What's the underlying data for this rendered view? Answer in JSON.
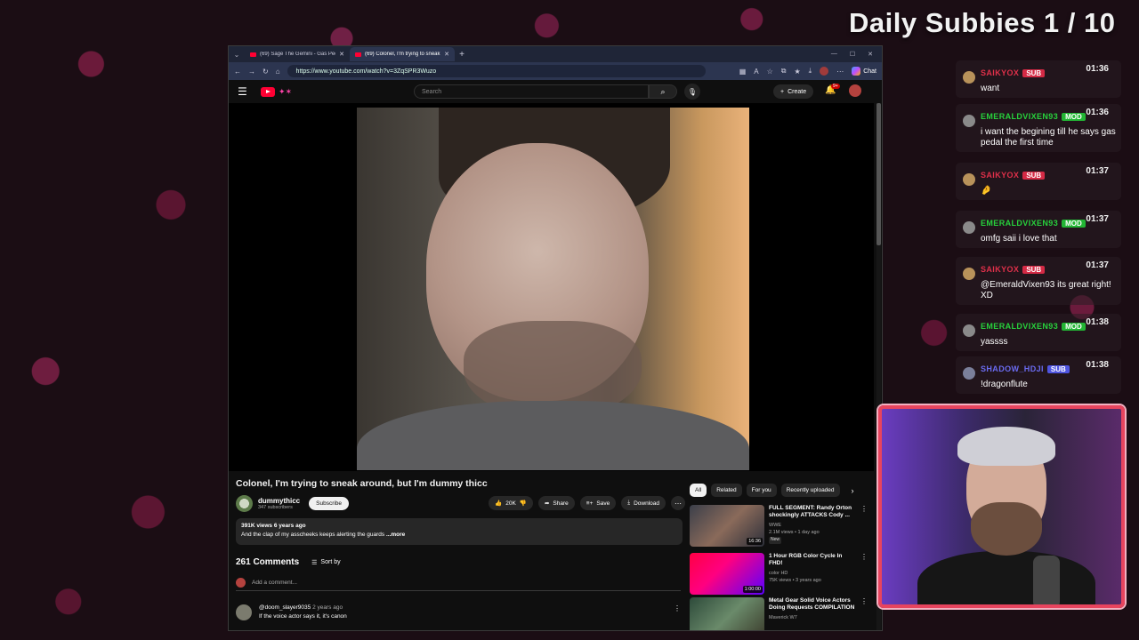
{
  "overlay": {
    "title": "Daily Subbies 1 / 10"
  },
  "browser": {
    "tabs": [
      {
        "label": "(69) Sage The Gemini - Gas Pedal",
        "active": false
      },
      {
        "label": "(69) Colonel, I'm trying to sneak a",
        "active": true
      }
    ],
    "url": "https://www.youtube.com/watch?v=3ZqSPR3Wuzo",
    "chat_label": "Chat"
  },
  "youtube": {
    "search_placeholder": "Search",
    "create_label": "Create",
    "notif_count": "9+",
    "video": {
      "title": "Colonel, I'm trying to sneak around, but I'm dummy thicc",
      "channel": "dummythicc",
      "subscribers": "347 subscribers",
      "subscribe_label": "Subscribe",
      "likes": "20K",
      "share_label": "Share",
      "save_label": "Save",
      "download_label": "Download",
      "views_age": "391K views  6 years ago",
      "description": "And the clap of my asscheeks keeps alerting the guards",
      "more_label": "...more"
    },
    "comments": {
      "count_label": "261 Comments",
      "sort_label": "Sort by",
      "add_placeholder": "Add a comment...",
      "items": [
        {
          "user": "@doom_slayer9035",
          "time": "2 years ago",
          "text": "If the voice actor says it, it's canon"
        }
      ]
    },
    "chips": [
      "All",
      "Related",
      "For you",
      "Recently uploaded"
    ],
    "recommendations": [
      {
        "title": "FULL SEGMENT: Randy Orton shockingly ATTACKS Cody ...",
        "channel": "WWE",
        "meta": "2.1M views • 1 day ago",
        "badge": "New",
        "duration": "16:36"
      },
      {
        "title": "1 Hour RGB Color Cycle In FHD!",
        "channel": "color HD",
        "meta": "75K views • 3 years ago",
        "badge": "",
        "duration": "1:00:00"
      },
      {
        "title": "Metal Gear Solid Voice Actors Doing Requests COMPILATION",
        "channel": "Maverick W7",
        "meta": "",
        "badge": "",
        "duration": ""
      }
    ]
  },
  "chat": [
    {
      "name": "SAIKYOX",
      "badge": "SUB",
      "time": "01:36",
      "text": "want",
      "name_color": "#e0304a",
      "badge_color": "#d42a45"
    },
    {
      "name": "EMERALDVIXEN93",
      "badge": "MOD",
      "time": "01:36",
      "text": "i want the begining till he says gas pedal the first time",
      "name_color": "#27d13c",
      "badge_color": "#22b534"
    },
    {
      "name": "SAIKYOX",
      "badge": "SUB",
      "time": "01:37",
      "text": "🤌",
      "name_color": "#e0304a",
      "badge_color": "#d42a45"
    },
    {
      "name": "EMERALDVIXEN93",
      "badge": "MOD",
      "time": "01:37",
      "text": "omfg saii i love that",
      "name_color": "#27d13c",
      "badge_color": "#22b534"
    },
    {
      "name": "SAIKYOX",
      "badge": "SUB",
      "time": "01:37",
      "text": "@EmeraldVixen93 its great right! XD",
      "name_color": "#e0304a",
      "badge_color": "#d42a45"
    },
    {
      "name": "EMERALDVIXEN93",
      "badge": "MOD",
      "time": "01:38",
      "text": "yassss",
      "name_color": "#27d13c",
      "badge_color": "#22b534"
    },
    {
      "name": "SHADOW_HDJI",
      "badge": "SUB",
      "time": "01:38",
      "text": "!dragonflute",
      "name_color": "#6a6bf0",
      "badge_color": "#4f55e0"
    }
  ]
}
